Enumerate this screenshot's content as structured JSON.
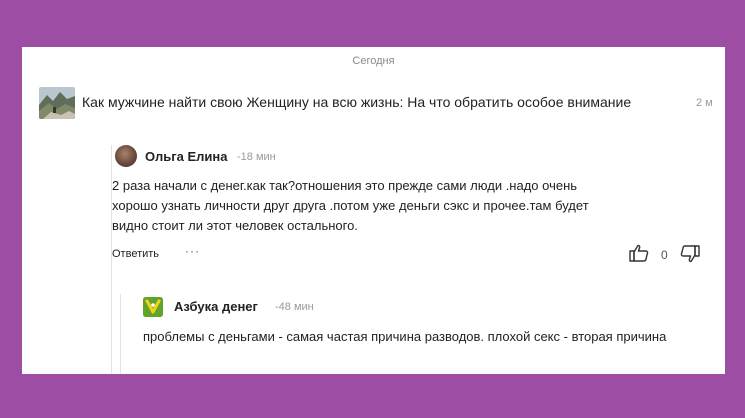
{
  "date_divider": "Сегодня",
  "post": {
    "title": "Как мужчине найти свою Женщину на всю жизнь: На что обратить особое внимание",
    "time": "2 м",
    "thumb_icon": "landscape-thumbnail"
  },
  "comments": [
    {
      "author": "Ольга Елина",
      "time": "-18 мин",
      "text": "2 раза начали с денег.как так?отношения это прежде сами люди .надо очень хорошо узнать личности друг друга .потом уже деньги сэкс и прочее.там будет видно стоит ли этот человек остального.",
      "reply_label": "Ответить",
      "more_label": "···",
      "likes": "0"
    },
    {
      "author": "Азбука денег",
      "time": "-48 мин",
      "text": "проблемы с деньгами - самая частая причина разводов. плохой секс - вторая причина",
      "brand_color": "#5fa52a"
    }
  ],
  "colors": {
    "frame_bg": "#9d4da3",
    "panel_bg": "#ffffff"
  }
}
